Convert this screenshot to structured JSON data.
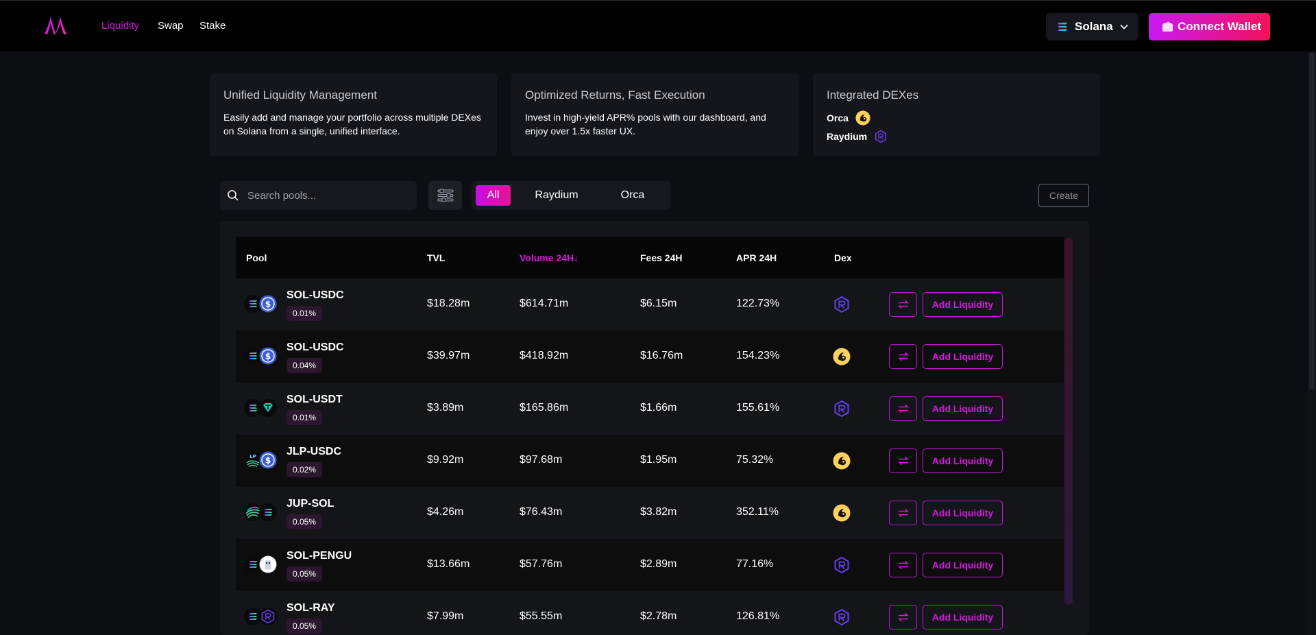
{
  "nav": {
    "links": [
      "Liquidity",
      "Swap",
      "Stake"
    ],
    "active": "Liquidity",
    "network": "Solana",
    "connect_label": "Connect Wallet"
  },
  "cards": [
    {
      "title": "Unified Liquidity Management",
      "desc": "Easily add and manage your portfolio across multiple DEXes on Solana from a single, unified interface."
    },
    {
      "title": "Optimized Returns, Fast Execution",
      "desc": "Invest in high-yield APR% pools with our dashboard, and enjoy over 1.5x faster UX."
    },
    {
      "title": "Integrated DEXes",
      "dexes": [
        "Orca",
        "Raydium"
      ]
    }
  ],
  "search": {
    "placeholder": "Search pools..."
  },
  "filters": {
    "options": [
      "All",
      "Raydium",
      "Orca"
    ],
    "active": "All"
  },
  "create_label": "Create",
  "table": {
    "headers": {
      "pool": "Pool",
      "tvl": "TVL",
      "volume": "Volume 24H",
      "fees": "Fees 24H",
      "apr": "APR 24H",
      "dex": "Dex"
    },
    "sort_arrow": "↓",
    "add_label": "Add Liquidity",
    "rows": [
      {
        "pool": "SOL-USDC",
        "fee": "0.01%",
        "tvl": "$18.28m",
        "volume": "$614.71m",
        "fees": "$6.15m",
        "apr": "122.73%",
        "dex": "raydium",
        "t1": "sol",
        "t2": "usdc"
      },
      {
        "pool": "SOL-USDC",
        "fee": "0.04%",
        "tvl": "$39.97m",
        "volume": "$418.92m",
        "fees": "$16.76m",
        "apr": "154.23%",
        "dex": "orca",
        "t1": "sol",
        "t2": "usdc"
      },
      {
        "pool": "SOL-USDT",
        "fee": "0.01%",
        "tvl": "$3.89m",
        "volume": "$165.86m",
        "fees": "$1.66m",
        "apr": "155.61%",
        "dex": "raydium",
        "t1": "sol",
        "t2": "usdt"
      },
      {
        "pool": "JLP-USDC",
        "fee": "0.02%",
        "tvl": "$9.92m",
        "volume": "$97.68m",
        "fees": "$1.95m",
        "apr": "75.32%",
        "dex": "orca",
        "t1": "jlp",
        "t2": "usdc"
      },
      {
        "pool": "JUP-SOL",
        "fee": "0.05%",
        "tvl": "$4.26m",
        "volume": "$76.43m",
        "fees": "$3.82m",
        "apr": "352.11%",
        "dex": "orca",
        "t1": "jup",
        "t2": "sol"
      },
      {
        "pool": "SOL-PENGU",
        "fee": "0.05%",
        "tvl": "$13.66m",
        "volume": "$57.76m",
        "fees": "$2.89m",
        "apr": "77.16%",
        "dex": "raydium",
        "t1": "sol",
        "t2": "pengu"
      },
      {
        "pool": "SOL-RAY",
        "fee": "0.05%",
        "tvl": "$7.99m",
        "volume": "$55.55m",
        "fees": "$2.78m",
        "apr": "126.81%",
        "dex": "raydium",
        "t1": "sol",
        "t2": "ray"
      }
    ]
  },
  "colors": {
    "accent": "#d418e0",
    "bg": "#0d0e11",
    "card": "#15161b"
  }
}
